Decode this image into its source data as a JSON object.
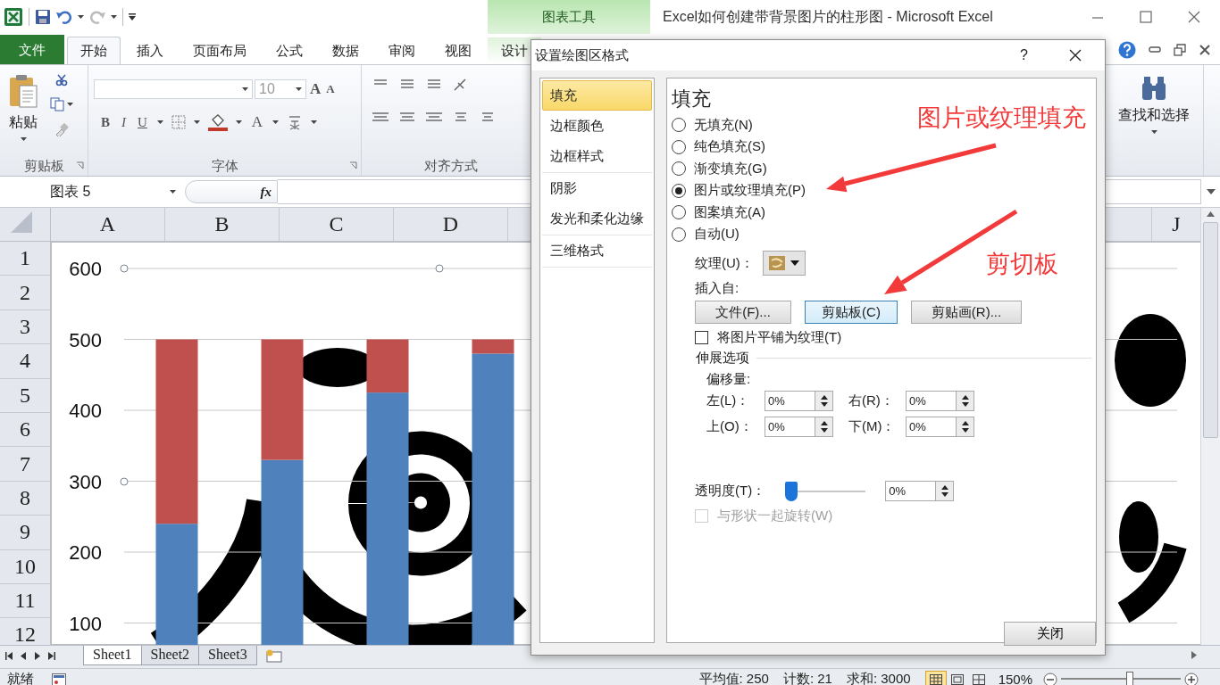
{
  "title_bar": {
    "context_tab": "图表工具",
    "title": "Excel如何创建带背景图片的柱形图 - Microsoft Excel"
  },
  "ribbon_tabs": [
    {
      "label": "文件",
      "kind": "file",
      "selected": false
    },
    {
      "label": "开始",
      "kind": "tab",
      "selected": true
    },
    {
      "label": "插入",
      "kind": "tab",
      "selected": false
    },
    {
      "label": "页面布局",
      "kind": "tab",
      "selected": false
    },
    {
      "label": "公式",
      "kind": "tab",
      "selected": false
    },
    {
      "label": "数据",
      "kind": "tab",
      "selected": false
    },
    {
      "label": "审阅",
      "kind": "tab",
      "selected": false
    },
    {
      "label": "视图",
      "kind": "tab",
      "selected": false
    },
    {
      "label": "设计",
      "kind": "context",
      "selected": false
    }
  ],
  "ribbon": {
    "clipboard": {
      "paste": "粘贴",
      "group": "剪贴板"
    },
    "font": {
      "font_size": "10",
      "grow": "A",
      "shrink": "A",
      "bold": "B",
      "italic": "I",
      "underline": "U",
      "font_color": "A",
      "group": "字体"
    },
    "alignment": {
      "group": "对齐方式"
    },
    "editing": {
      "find": "查找和选择"
    }
  },
  "formula_bar": {
    "name_box": "图表 5",
    "function_label": "fx"
  },
  "grid": {
    "columns": [
      "A",
      "B",
      "C",
      "D",
      "J"
    ],
    "rows": [
      "1",
      "2",
      "3",
      "4",
      "5",
      "6",
      "7",
      "8",
      "9",
      "10",
      "11",
      "12"
    ]
  },
  "chart": {
    "chart_data": {
      "type": "bar",
      "stacked": true,
      "orientation": "vertical",
      "grid": true,
      "ylim": [
        0,
        600
      ],
      "yticks": [
        100,
        200,
        300,
        400,
        500,
        600
      ],
      "series": [
        {
          "color": "#4f81bd",
          "values": [
            240,
            330,
            425,
            480
          ]
        },
        {
          "color": "#c0504d",
          "values": [
            260,
            170,
            75,
            20
          ]
        }
      ]
    }
  },
  "sheet_tabs": [
    {
      "label": "Sheet1",
      "selected": true
    },
    {
      "label": "Sheet2",
      "selected": false
    },
    {
      "label": "Sheet3",
      "selected": false
    }
  ],
  "status_bar": {
    "ready": "就绪",
    "average": "平均值: 250",
    "count": "计数: 21",
    "sum": "求和: 3000",
    "views": [
      {
        "kind": "normal",
        "selected": true
      },
      {
        "kind": "page_layout",
        "selected": false
      },
      {
        "kind": "page_break",
        "selected": false
      }
    ],
    "zoom": "150%",
    "zoom_slider": {
      "level": 0.58
    }
  },
  "dialog": {
    "title": "设置绘图区格式",
    "help": "?",
    "category_groups": [
      [
        {
          "label": "填充",
          "selected": true
        },
        {
          "label": "边框颜色",
          "selected": false
        },
        {
          "label": "边框样式",
          "selected": false
        }
      ],
      [
        {
          "label": "阴影",
          "selected": false
        },
        {
          "label": "发光和柔化边缘",
          "selected": false
        }
      ],
      [
        {
          "label": "三维格式",
          "selected": false
        }
      ]
    ],
    "heading": "填充",
    "fill_options": [
      {
        "label": "无填充(N)",
        "selected": false
      },
      {
        "label": "纯色填充(S)",
        "selected": false
      },
      {
        "label": "渐变填充(G)",
        "selected": false
      },
      {
        "label": "图片或纹理填充(P)",
        "selected": true
      },
      {
        "label": "图案填充(A)",
        "selected": false
      },
      {
        "label": "自动(U)",
        "selected": false
      }
    ],
    "texture_label": "纹理(U)：",
    "insert_from_label": "插入自:",
    "insert_buttons": [
      {
        "label": "文件(F)...",
        "highlighted": false
      },
      {
        "label": "剪贴板(C)",
        "highlighted": true
      },
      {
        "label": "剪贴画(R)...",
        "highlighted": false
      }
    ],
    "tile": {
      "label": "将图片平铺为纹理(T)",
      "checked": false,
      "disabled": false
    },
    "stretch_heading": "伸展选项",
    "offset_label": "偏移量:",
    "offsets": [
      {
        "label": "左(L)：",
        "value": "0%"
      },
      {
        "label": "右(R)：",
        "value": "0%"
      },
      {
        "label": "上(O)：",
        "value": "0%"
      },
      {
        "label": "下(M)：",
        "value": "0%"
      }
    ],
    "transparency": {
      "label": "透明度(T)：",
      "level": 0,
      "value": "0%"
    },
    "rotate": {
      "label": "与形状一起旋转(W)",
      "checked": false,
      "disabled": true
    },
    "close": "关闭"
  },
  "annotations": [
    {
      "text": "图片或纹理填充"
    },
    {
      "text": "剪切板"
    }
  ]
}
